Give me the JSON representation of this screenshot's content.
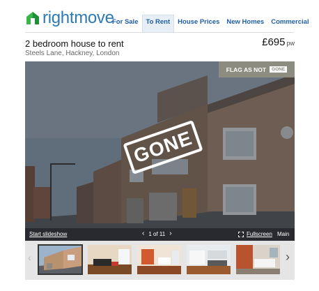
{
  "brand": {
    "name": "rightmove",
    "color": "#2d7ab4",
    "icon": "house-logo-icon"
  },
  "nav": {
    "items": [
      {
        "label": "For Sale",
        "active": false
      },
      {
        "label": "To Rent",
        "active": true
      },
      {
        "label": "House Prices",
        "active": false
      },
      {
        "label": "New Homes",
        "active": false
      },
      {
        "label": "Commercial",
        "active": false
      }
    ]
  },
  "listing": {
    "title": "2 bedroom house to rent",
    "address": "Steels Lane, Hackney, London",
    "price": "£695",
    "price_unit": "pw"
  },
  "gallery": {
    "flag_label": "FLAG AS NOT",
    "flag_badge": "GONE",
    "stamp_text": "GONE",
    "slideshow_label": "Start slideshow",
    "counter": "1 of 11",
    "fullscreen_label": "Fullscreen",
    "main_label": "Main",
    "prev_icon": "chevron-left-icon",
    "next_icon": "chevron-right-icon"
  },
  "thumbnails": {
    "selected_index": 0,
    "items": [
      {
        "name": "thumb-exterior"
      },
      {
        "name": "thumb-living-room"
      },
      {
        "name": "thumb-kitchen-dining"
      },
      {
        "name": "thumb-kitchen"
      },
      {
        "name": "thumb-bathroom"
      }
    ],
    "next_icon": "chevron-right-icon"
  }
}
